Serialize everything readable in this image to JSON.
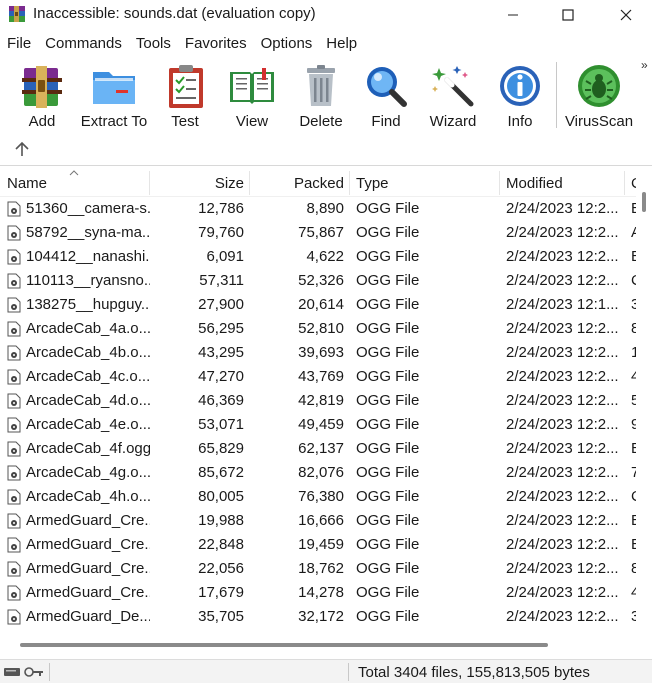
{
  "window": {
    "title": "Inaccessible: sounds.dat (evaluation copy)"
  },
  "menu": [
    "File",
    "Commands",
    "Tools",
    "Favorites",
    "Options",
    "Help"
  ],
  "toolbar": {
    "buttons": [
      {
        "label": "Add",
        "icon": "add-archive-icon"
      },
      {
        "label": "Extract To",
        "icon": "extract-folder-icon"
      },
      {
        "label": "Test",
        "icon": "test-clipboard-icon"
      },
      {
        "label": "View",
        "icon": "view-book-icon"
      },
      {
        "label": "Delete",
        "icon": "trash-icon"
      },
      {
        "label": "Find",
        "icon": "magnifier-icon"
      },
      {
        "label": "Wizard",
        "icon": "magic-wand-icon"
      },
      {
        "label": "Info",
        "icon": "info-icon"
      },
      {
        "label": "VirusScan",
        "icon": "virus-scan-icon"
      }
    ],
    "more": "»"
  },
  "columns": {
    "name": "Name",
    "size": "Size",
    "packed": "Packed",
    "type": "Type",
    "modified": "Modified",
    "crc": "C"
  },
  "files": [
    {
      "name": "51360__camera-s...",
      "size": "12,786",
      "packed": "8,890",
      "type": "OGG File",
      "modified": "2/24/2023 12:2...",
      "crc": "E"
    },
    {
      "name": "58792__syna-ma...",
      "size": "79,760",
      "packed": "75,867",
      "type": "OGG File",
      "modified": "2/24/2023 12:2...",
      "crc": "A"
    },
    {
      "name": "104412__nanashi...",
      "size": "6,091",
      "packed": "4,622",
      "type": "OGG File",
      "modified": "2/24/2023 12:2...",
      "crc": "E"
    },
    {
      "name": "110113__ryansno...",
      "size": "57,311",
      "packed": "52,326",
      "type": "OGG File",
      "modified": "2/24/2023 12:2...",
      "crc": "C"
    },
    {
      "name": "138275__hupguy...",
      "size": "27,900",
      "packed": "20,614",
      "type": "OGG File",
      "modified": "2/24/2023 12:1...",
      "crc": "3"
    },
    {
      "name": "ArcadeCab_4a.o...",
      "size": "56,295",
      "packed": "52,810",
      "type": "OGG File",
      "modified": "2/24/2023 12:2...",
      "crc": "8"
    },
    {
      "name": "ArcadeCab_4b.o...",
      "size": "43,295",
      "packed": "39,693",
      "type": "OGG File",
      "modified": "2/24/2023 12:2...",
      "crc": "1"
    },
    {
      "name": "ArcadeCab_4c.o...",
      "size": "47,270",
      "packed": "43,769",
      "type": "OGG File",
      "modified": "2/24/2023 12:2...",
      "crc": "4"
    },
    {
      "name": "ArcadeCab_4d.o...",
      "size": "46,369",
      "packed": "42,819",
      "type": "OGG File",
      "modified": "2/24/2023 12:2...",
      "crc": "5"
    },
    {
      "name": "ArcadeCab_4e.o...",
      "size": "53,071",
      "packed": "49,459",
      "type": "OGG File",
      "modified": "2/24/2023 12:2...",
      "crc": "9"
    },
    {
      "name": "ArcadeCab_4f.ogg",
      "size": "65,829",
      "packed": "62,137",
      "type": "OGG File",
      "modified": "2/24/2023 12:2...",
      "crc": "E"
    },
    {
      "name": "ArcadeCab_4g.o...",
      "size": "85,672",
      "packed": "82,076",
      "type": "OGG File",
      "modified": "2/24/2023 12:2...",
      "crc": "7"
    },
    {
      "name": "ArcadeCab_4h.o...",
      "size": "80,005",
      "packed": "76,380",
      "type": "OGG File",
      "modified": "2/24/2023 12:2...",
      "crc": "C"
    },
    {
      "name": "ArmedGuard_Cre...",
      "size": "19,988",
      "packed": "16,666",
      "type": "OGG File",
      "modified": "2/24/2023 12:2...",
      "crc": "E"
    },
    {
      "name": "ArmedGuard_Cre...",
      "size": "22,848",
      "packed": "19,459",
      "type": "OGG File",
      "modified": "2/24/2023 12:2...",
      "crc": "E"
    },
    {
      "name": "ArmedGuard_Cre...",
      "size": "22,056",
      "packed": "18,762",
      "type": "OGG File",
      "modified": "2/24/2023 12:2...",
      "crc": "8"
    },
    {
      "name": "ArmedGuard_Cre...",
      "size": "17,679",
      "packed": "14,278",
      "type": "OGG File",
      "modified": "2/24/2023 12:2...",
      "crc": "4"
    },
    {
      "name": "ArmedGuard_De...",
      "size": "35,705",
      "packed": "32,172",
      "type": "OGG File",
      "modified": "2/24/2023 12:2...",
      "crc": "3"
    }
  ],
  "status": {
    "summary": "Total 3404 files, 155,813,505 bytes"
  }
}
